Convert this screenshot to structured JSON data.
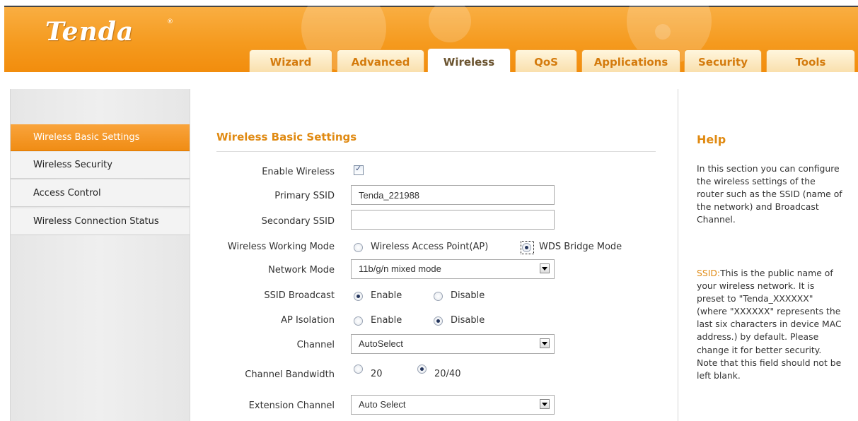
{
  "brand": {
    "logo": "Tenda",
    "logo_mark": "®"
  },
  "nav_tabs": [
    "Wizard",
    "Advanced",
    "Wireless",
    "QoS",
    "Applications",
    "Security",
    "Tools"
  ],
  "active_tab": "Wireless",
  "sidebar": {
    "items": [
      "Wireless Basic Settings",
      "Wireless Security",
      "Access Control",
      "Wireless Connection Status"
    ],
    "active": "Wireless Basic Settings"
  },
  "section_title": "Wireless Basic Settings",
  "form": {
    "enable_wireless": {
      "label": "Enable Wireless",
      "checked": true
    },
    "primary_ssid": {
      "label": "Primary SSID",
      "value": "Tenda_221988"
    },
    "secondary_ssid": {
      "label": "Secondary SSID",
      "value": ""
    },
    "working_mode": {
      "label": "Wireless Working Mode",
      "options": [
        "Wireless Access Point(AP)",
        "WDS Bridge Mode"
      ],
      "selected": "WDS Bridge Mode"
    },
    "network_mode": {
      "label": "Network Mode",
      "value": "11b/g/n mixed mode"
    },
    "ssid_broadcast": {
      "label": "SSID Broadcast",
      "options": [
        "Enable",
        "Disable"
      ],
      "selected": "Enable"
    },
    "ap_isolation": {
      "label": "AP Isolation",
      "options": [
        "Enable",
        "Disable"
      ],
      "selected": "Disable"
    },
    "channel": {
      "label": "Channel",
      "value": "AutoSelect"
    },
    "channel_bandwidth": {
      "label": "Channel Bandwidth",
      "options": [
        "20",
        "20/40"
      ],
      "selected": "20/40"
    },
    "extension_channel": {
      "label": "Extension Channel",
      "value": "Auto Select"
    }
  },
  "help": {
    "title": "Help",
    "intro": "In this section you can configure the wireless settings of the router such as the SSID (name of the network) and Broadcast Channel.",
    "ssid_key": "SSID:",
    "ssid_text": "This is the public name of your wireless network. It is preset to \"Tenda_XXXXXX\" (where \"XXXXXX\" represents the last six characters in device MAC address.) by default. Please change it for better security. Note that this field should not be left blank."
  },
  "colors": {
    "accent": "#f59a1e",
    "title": "#e08a12",
    "sidebar_active": "#f08c14"
  }
}
